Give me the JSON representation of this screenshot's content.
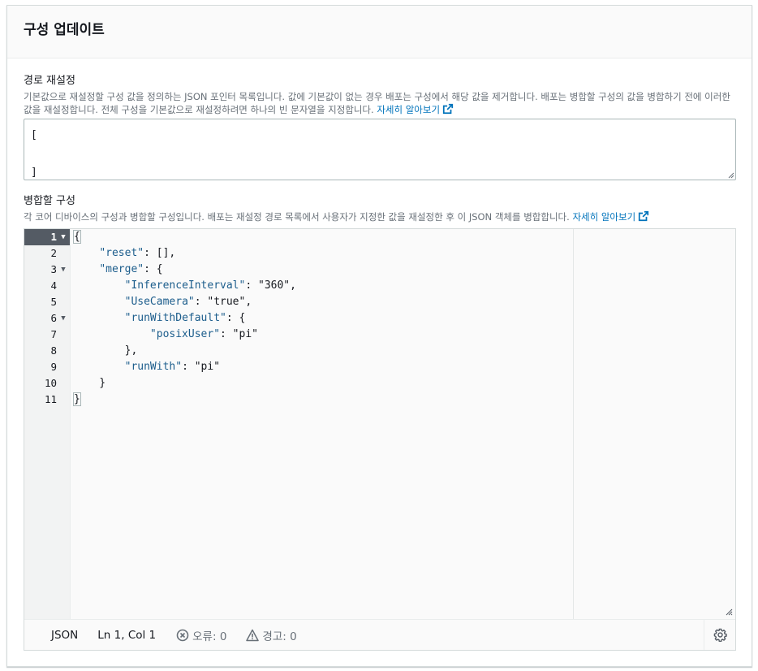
{
  "panel": {
    "title": "구성 업데이트"
  },
  "reset_field": {
    "label": "경로 재설정",
    "description": "기본값으로 재설정할 구성 값을 정의하는 JSON 포인터 목록입니다. 값에 기본값이 없는 경우 배포는 구성에서 해당 값을 제거합니다. 배포는 병합할 구성의 값을 병합하기 전에 이러한 값을 재설정합니다. 전체 구성을 기본값으로 재설정하려면 하나의 빈 문자열을 지정합니다.",
    "link_label": "자세히 알아보기",
    "link_icon": "external-link-icon",
    "value_lines": [
      "[",
      "",
      "]"
    ]
  },
  "merge_field": {
    "label": "병합할 구성",
    "description": "각 코어 디바이스의 구성과 병합할 구성입니다. 배포는 재설정 경로 목록에서 사용자가 지정한 값을 재설정한 후 이 JSON 객체를 병합합니다.",
    "link_label": "자세히 알아보기",
    "link_icon": "external-link-icon"
  },
  "editor": {
    "line_numbers": [
      "1",
      "2",
      "3",
      "4",
      "5",
      "6",
      "7",
      "8",
      "9",
      "10",
      "11"
    ],
    "fold_lines": [
      1,
      3,
      6
    ],
    "active_line": 1,
    "lines": [
      "{",
      "    \"reset\": [],",
      "    \"merge\": {",
      "        \"InferenceInterval\": \"360\",",
      "        \"UseCamera\": \"true\",",
      "        \"runWithDefault\": {",
      "            \"posixUser\": \"pi\"",
      "        },",
      "        \"runWith\": \"pi\"",
      "    }",
      "}"
    ]
  },
  "statusbar": {
    "language": "JSON",
    "position": "Ln 1, Col 1",
    "errors_label": "오류: 0",
    "warnings_label": "경고: 0",
    "errors_icon": "error-circle-icon",
    "warnings_icon": "warning-triangle-icon",
    "settings_icon": "gear-icon"
  },
  "colors": {
    "link": "#0073bb",
    "json_key": "#1c5d8c",
    "active_gutter": "#545b64"
  }
}
